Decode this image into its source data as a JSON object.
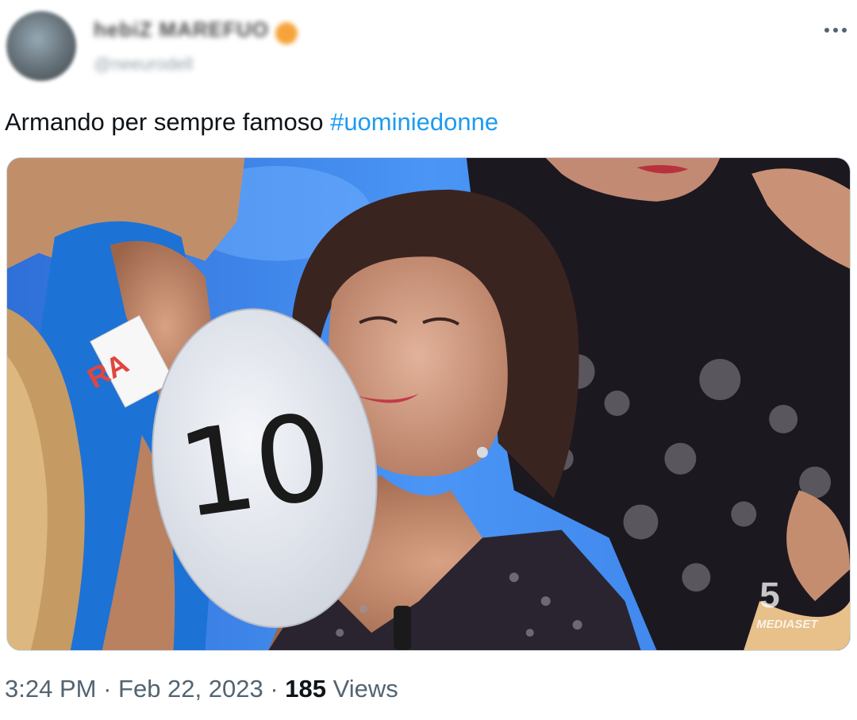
{
  "author": {
    "display_name": "hebiZ MAREFUO",
    "handle": "@neeurodell",
    "avatar_icon": "avatar-image",
    "badge_icon": "emoji-badge"
  },
  "more_icon": "more-horizontal-icon",
  "tweet": {
    "text": "Armando per sempre famoso ",
    "hashtag": "#uominiedonne"
  },
  "media": {
    "paddle_number": "10",
    "name_tag": "RA",
    "watermark_channel": "5",
    "watermark_brand": "MEDIASET"
  },
  "meta": {
    "time": "3:24 PM",
    "separator": " · ",
    "date": "Feb 22, 2023",
    "views_count": "185",
    "views_label": " Views"
  },
  "colors": {
    "hashtag": "#1d9bf0",
    "meta_text": "#536471",
    "studio_blue": "#3b86f0"
  }
}
